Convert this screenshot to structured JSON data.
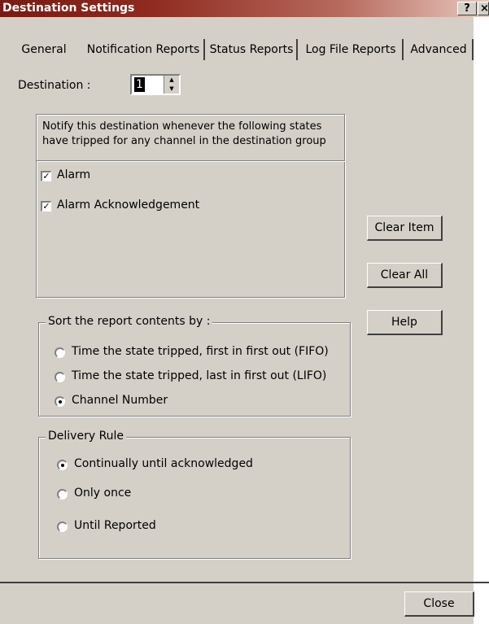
{
  "window": {
    "title": "Destination Settings",
    "help_button": "?",
    "close_button": "×"
  },
  "tabs": [
    {
      "label": "General"
    },
    {
      "label": "Notification Reports",
      "active": true
    },
    {
      "label": "Status Reports"
    },
    {
      "label": "Log File Reports"
    },
    {
      "label": "Advanced"
    }
  ],
  "destination": {
    "label": "Destination :",
    "value": "1"
  },
  "notify": {
    "description_line1": "Notify this destination whenever the following states",
    "description_line2": "have tripped for any channel in the destination group",
    "items": [
      {
        "label": "Alarm",
        "checked": true
      },
      {
        "label": "Alarm Acknowledgement",
        "checked": true
      }
    ]
  },
  "buttons": {
    "clear_item": "Clear Item",
    "clear_all": "Clear All",
    "help": "Help",
    "close": "Close"
  },
  "sort": {
    "title": "Sort the report contents by :",
    "options": [
      {
        "label": "Time the state tripped, first in first out (FIFO)",
        "selected": false
      },
      {
        "label": "Time the state tripped, last in first out (LIFO)",
        "selected": false
      },
      {
        "label": "Channel Number",
        "selected": true
      }
    ]
  },
  "delivery": {
    "title": "Delivery Rule",
    "options": [
      {
        "label": "Continually until acknowledged",
        "selected": true
      },
      {
        "label": "Only once",
        "selected": false
      },
      {
        "label": "Until Reported",
        "selected": false
      }
    ]
  }
}
